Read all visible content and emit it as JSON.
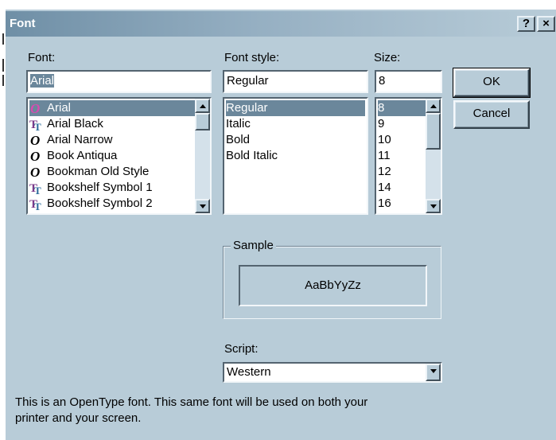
{
  "dialog": {
    "title": "Font",
    "help_button": "?",
    "close_button": "×"
  },
  "font": {
    "label": "Font:",
    "value": "Arial",
    "items": [
      {
        "name": "Arial",
        "icon": "opentype-font-icon",
        "selected": true
      },
      {
        "name": "Arial Black",
        "icon": "truetype-font-icon"
      },
      {
        "name": "Arial Narrow",
        "icon": "opentype-font-icon"
      },
      {
        "name": "Book Antiqua",
        "icon": "opentype-font-icon"
      },
      {
        "name": "Bookman Old Style",
        "icon": "opentype-font-icon"
      },
      {
        "name": "Bookshelf Symbol 1",
        "icon": "truetype-font-icon"
      },
      {
        "name": "Bookshelf Symbol 2",
        "icon": "truetype-font-icon"
      }
    ]
  },
  "style": {
    "label": "Font style:",
    "value": "Regular",
    "items": [
      "Regular",
      "Italic",
      "Bold",
      "Bold Italic"
    ]
  },
  "size": {
    "label": "Size:",
    "value": "8",
    "items": [
      "8",
      "9",
      "10",
      "11",
      "12",
      "14",
      "16"
    ]
  },
  "buttons": {
    "ok": "OK",
    "cancel": "Cancel"
  },
  "sample": {
    "label": "Sample",
    "text": "AaBbYyZz"
  },
  "script": {
    "label": "Script:",
    "value": "Western"
  },
  "description": {
    "line1": "This is an OpenType font. This same font will be used on both your",
    "line2": "printer and your screen."
  },
  "colors": {
    "dialog_bg": "#b8ccd8",
    "selection": "#6b879b",
    "opentype_icon": "#000000",
    "truetype_icon": "#7a3a8a"
  }
}
